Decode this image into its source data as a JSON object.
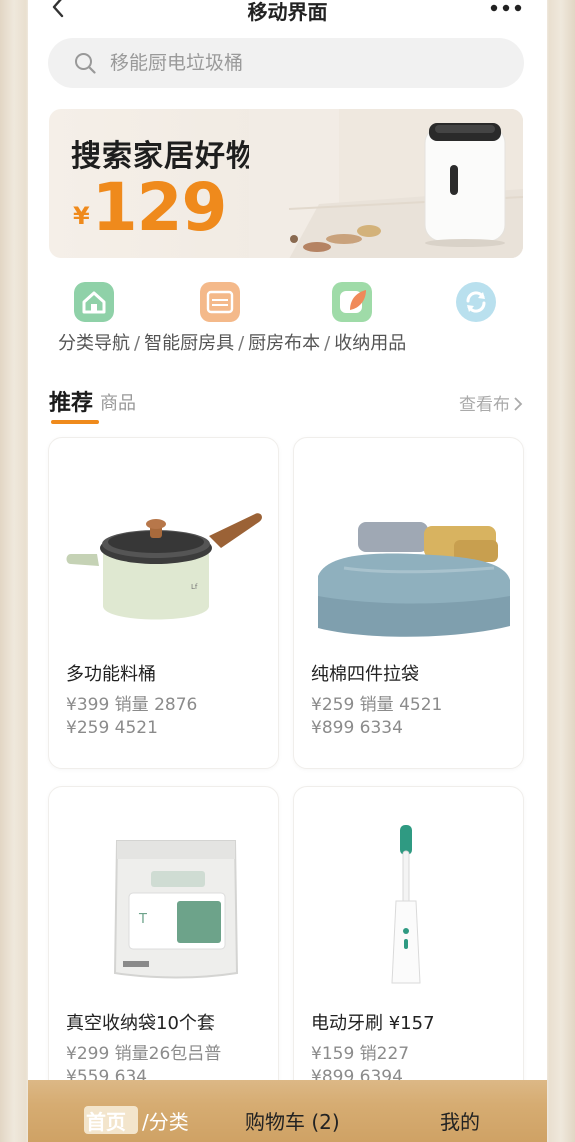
{
  "header": {
    "title": "移动界面"
  },
  "search": {
    "placeholder": "移能厨电垃圾桶"
  },
  "banner": {
    "title": "搜索家居好物",
    "currency": "¥",
    "price": "129"
  },
  "categories": [
    {
      "label": "分类导航",
      "icon": "home-icon",
      "color": "#7fc79a"
    },
    {
      "label": "智能厨房具",
      "icon": "calendar-icon",
      "color": "#f2b27a"
    },
    {
      "label": "厨房布本",
      "icon": "leaf-icon",
      "color": "#8fd19a"
    },
    {
      "label": "收纳用品",
      "icon": "refresh-icon",
      "color": "#9fd3e6"
    }
  ],
  "separator": "/",
  "recommend": {
    "title": "推荐",
    "subtitle": "商品",
    "more": "查看布"
  },
  "products": [
    {
      "name": "多功能料桶",
      "line1": "¥399 销量 2876",
      "line2": "¥259 4521",
      "image": "pot-image"
    },
    {
      "name": "纯棉四件拉袋",
      "line1": "¥259 销量 4521",
      "line2": "¥899 6334",
      "image": "bedding-image"
    },
    {
      "name": "真空收纳袋10个套",
      "line1": "¥299 销量26包吕普",
      "line2": "¥559 634",
      "image": "storage-bag-image"
    },
    {
      "name": "电动牙刷 ¥157",
      "line1": "¥159 销227",
      "line2": "¥899 6394",
      "image": "toothbrush-image"
    }
  ],
  "bottom_nav": {
    "home": "首页",
    "separator": "/",
    "category": "分类",
    "cart": "购物车 (2)",
    "me": "我的"
  },
  "colors": {
    "accent": "#ef8a1c",
    "nav_bar": "#d6ac72"
  }
}
